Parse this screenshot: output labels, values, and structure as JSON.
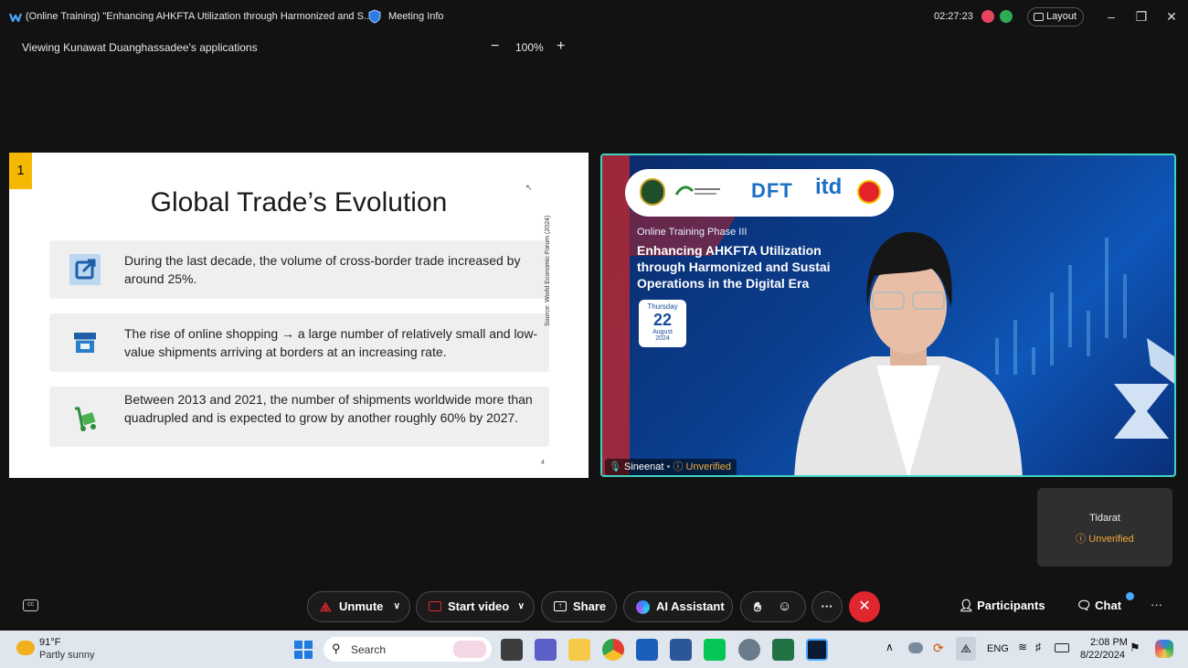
{
  "titlebar": {
    "meeting_title": "(Online Training) \"Enhancing AHKFTA Utilization through Harmonized and S...",
    "meeting_info": "Meeting Info",
    "timer": "02:27:23",
    "layout": "Layout"
  },
  "viewbar": {
    "viewing": "Viewing Kunawat Duanghassadee's applications",
    "zoom": "100%",
    "zoom_out": "−",
    "zoom_in": "+"
  },
  "slide": {
    "number": "1",
    "title": "Global Trade’s Evolution",
    "bullets": [
      {
        "icon": "external-link-icon",
        "text": "During the last decade, the volume of cross-border trade increased by around 25%."
      },
      {
        "icon": "storefront-icon",
        "text": "The rise of online shopping  → a large number of relatively small and low-value shipments arriving at borders at an increasing rate."
      },
      {
        "icon": "hand-truck-icon",
        "text": "Between 2013 and 2021, the number of shipments worldwide more than quadrupled and is expected to grow by another roughly 60% by 2027."
      }
    ],
    "source": "Source: World Economic Forum (2024)",
    "page": "4"
  },
  "video": {
    "banner_logos": "DFT",
    "banner_logo2": "itd",
    "phase": "Online Training Phase III",
    "headline": [
      "Enhancing AHKFTA Utilization",
      "through Harmonized and Sustai",
      "Operations in the Digital Era"
    ],
    "date_day": "Thursday",
    "date_num": "22",
    "date_month": "August",
    "date_year": "2024",
    "name": "Sineenat",
    "status": "Unverified"
  },
  "tile2": {
    "name": "Tidarat",
    "status": "Unverified"
  },
  "controls": {
    "unmute": "Unmute",
    "start_video": "Start video",
    "share": "Share",
    "ai_assistant": "AI Assistant",
    "more": "···",
    "participants": "Participants",
    "chat": "Chat"
  },
  "taskbar": {
    "weather_temp": "91°F",
    "weather_desc": "Partly sunny",
    "search": "Search",
    "lang": "ENG",
    "time": "2:08 PM",
    "date": "8/22/2024"
  },
  "colors": {
    "accent_teal": "#3fd3c1",
    "end_red": "#e0262f",
    "unverified": "#f0a93b",
    "slide_number_bg": "#f5b800"
  }
}
